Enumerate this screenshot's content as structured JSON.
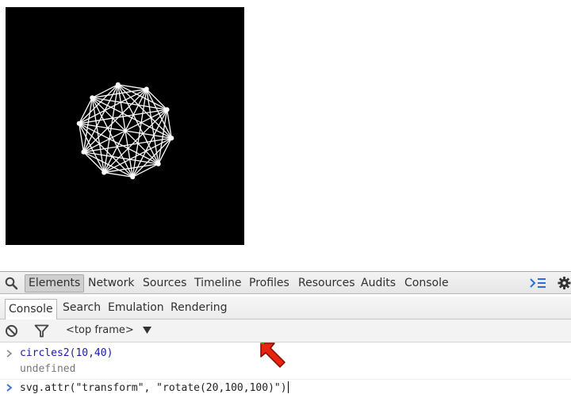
{
  "page": {
    "canvas_background": "#000000",
    "figure_stroke": "#ffffff"
  },
  "devtools": {
    "main_tabs": [
      {
        "label": "Elements",
        "selected": true
      },
      {
        "label": "Network"
      },
      {
        "label": "Sources"
      },
      {
        "label": "Timeline"
      },
      {
        "label": "Profiles"
      },
      {
        "label": "Resources"
      },
      {
        "label": "Audits"
      },
      {
        "label": "Console"
      }
    ],
    "drawer_tabs": [
      {
        "label": "Console",
        "selected": true
      },
      {
        "label": "Search"
      },
      {
        "label": "Emulation"
      },
      {
        "label": "Rendering"
      }
    ],
    "frame_selector": "<top frame>",
    "console_lines": [
      {
        "type": "command",
        "text": "circles2(10,40)"
      },
      {
        "type": "result",
        "text": "undefined"
      },
      {
        "type": "input",
        "text": "svg.attr(\"transform\", \"rotate(20,100,100)\")"
      }
    ],
    "icons": {
      "search": "search-icon",
      "drawer": "show-drawer-icon",
      "settings": "gear-icon",
      "clear": "clear-console-icon",
      "filter": "filter-icon",
      "dropdown": "dropdown-arrow-icon",
      "cursor": "mouse-cursor-arrow"
    },
    "colors": {
      "command": "#1a1aa6",
      "result": "#777777",
      "prompt": "#3b6fd6",
      "accent": "#1a73e8"
    }
  }
}
